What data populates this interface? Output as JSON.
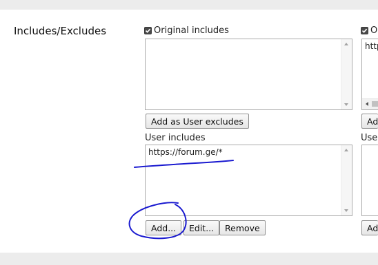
{
  "section_title": "Includes/Excludes",
  "original_includes": {
    "label": "Original includes",
    "checked": true,
    "value": "",
    "add_button": "Add as User excludes"
  },
  "user_includes": {
    "label": "User includes",
    "value": "https://forum.ge/*",
    "buttons": {
      "add": "Add...",
      "edit": "Edit...",
      "remove": "Remove"
    }
  },
  "right_column": {
    "checkbox_label": "O",
    "textarea_text": "http",
    "button_label": "Ad",
    "user_label": "User",
    "bottom_button_label": "Ad"
  },
  "annotation": {
    "color": "#1a1ad0"
  }
}
